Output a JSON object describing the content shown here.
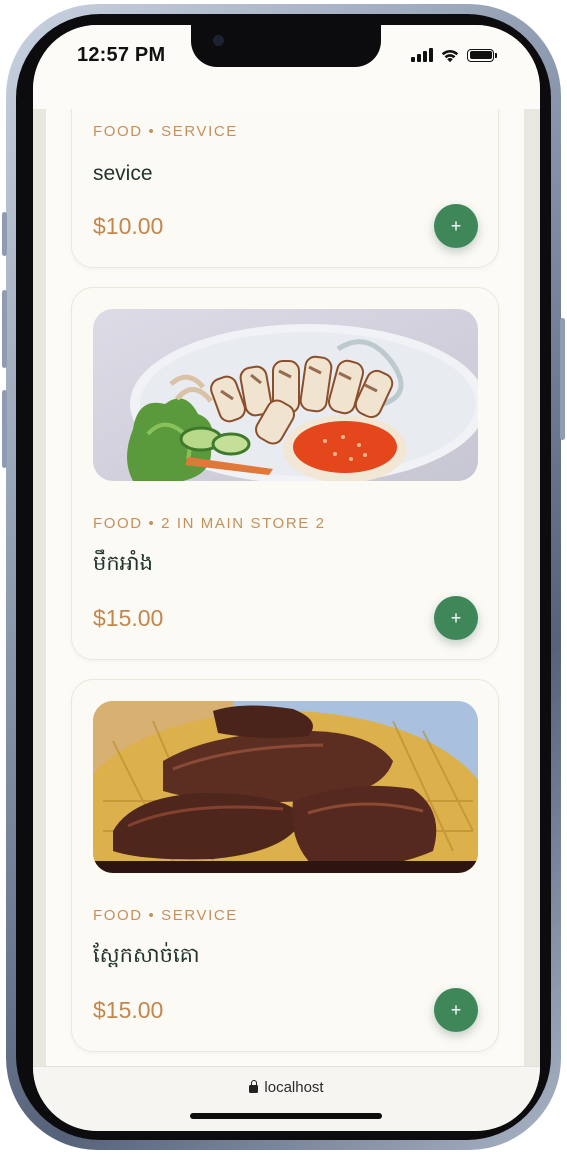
{
  "status_bar": {
    "time": "12:57 PM",
    "icons": [
      "cellular-signal-icon",
      "wifi-icon",
      "battery-icon"
    ]
  },
  "products": [
    {
      "meta": "FOOD • SERVICE",
      "name": "sevice",
      "price": "$10.00",
      "add_label": "+",
      "image": null
    },
    {
      "meta": "FOOD • 2 IN MAIN STORE 2",
      "name": "មឹកអាំង",
      "price": "$15.00",
      "add_label": "+",
      "image": "grilled-squid-with-dipping-sauce"
    },
    {
      "meta": "FOOD • SERVICE",
      "name": "ស្ពែកសាច់គោ",
      "price": "$15.00",
      "add_label": "+",
      "image": "dried-beef-on-woven-basket"
    }
  ],
  "browser": {
    "url": "localhost",
    "lock_icon": "lock-icon"
  },
  "colors": {
    "meta": "#c3915c",
    "price": "#c3874c",
    "name": "#23352f",
    "add_button": "#3f8758",
    "card_bg": "#fcfaf5",
    "page_bg": "#e9e8e0"
  }
}
